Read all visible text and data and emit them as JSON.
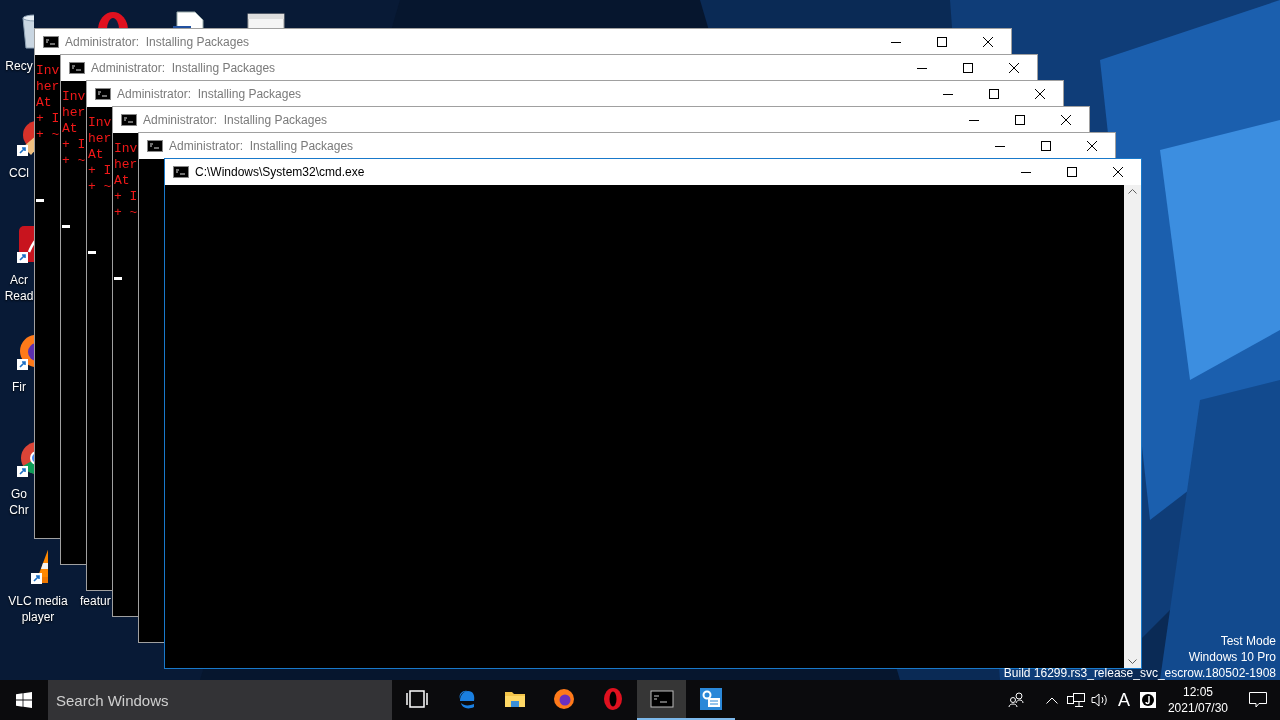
{
  "desktop": {
    "icons": [
      {
        "kind": "recycle-bin",
        "label": "Recy",
        "cut": true
      },
      {
        "kind": "ring-logo"
      },
      {
        "kind": "document"
      },
      {
        "kind": "window-file"
      },
      {
        "kind": "cleaner",
        "label": "CCl",
        "cut": true
      },
      {
        "kind": "reader",
        "label": "Acr Read",
        "cut": true
      },
      {
        "kind": "fox",
        "label": "Fir",
        "cut": true
      },
      {
        "kind": "chrome",
        "label": "Go Chr",
        "cut": true
      },
      {
        "kind": "cone",
        "label": "VLC media player",
        "cut": false
      },
      {
        "label": "featur",
        "cut": true
      }
    ],
    "system_info": [
      "Test Mode",
      "Windows 10 Pro",
      "Build 16299.rs3_release_svc_escrow.180502-1908"
    ]
  },
  "windows": [
    {
      "title": "Administrator:  Installing Packages",
      "active": false,
      "console_lines": [
        "Inv",
        "her",
        "At",
        "+ I",
        "+ ~"
      ],
      "cursor": true
    },
    {
      "title": "Administrator:  Installing Packages",
      "active": false,
      "console_lines": [
        "Inv",
        "her",
        "At",
        "+ I",
        "+ ~"
      ],
      "cursor": true
    },
    {
      "title": "Administrator:  Installing Packages",
      "active": false,
      "console_lines": [
        "Inv",
        "her",
        "At",
        "+ I",
        "+ ~"
      ],
      "cursor": true
    },
    {
      "title": "Administrator:  Installing Packages",
      "active": false,
      "console_lines": [
        "Inv",
        "her",
        "At",
        "+ I",
        "+ ~"
      ],
      "cursor": true
    },
    {
      "title": "Administrator:  Installing Packages",
      "active": false,
      "cursor": false
    },
    {
      "title": "C:\\Windows\\System32\\cmd.exe",
      "active": true,
      "cursor": false
    }
  ],
  "taskbar": {
    "search": {
      "placeholder": "Search Windows"
    },
    "apps": [
      {
        "kind": "task-view",
        "active": false,
        "running": false
      },
      {
        "kind": "edge",
        "active": false,
        "running": false
      },
      {
        "kind": "folder",
        "active": false,
        "running": false
      },
      {
        "kind": "fox",
        "active": false,
        "running": false
      },
      {
        "kind": "ring-logo",
        "active": false,
        "running": false
      },
      {
        "kind": "terminal",
        "active": true,
        "running": true
      },
      {
        "kind": "settings-app",
        "active": false,
        "running": true
      }
    ],
    "tray": {
      "ime": "A",
      "time": "12:05",
      "date": "2021/07/30"
    }
  }
}
